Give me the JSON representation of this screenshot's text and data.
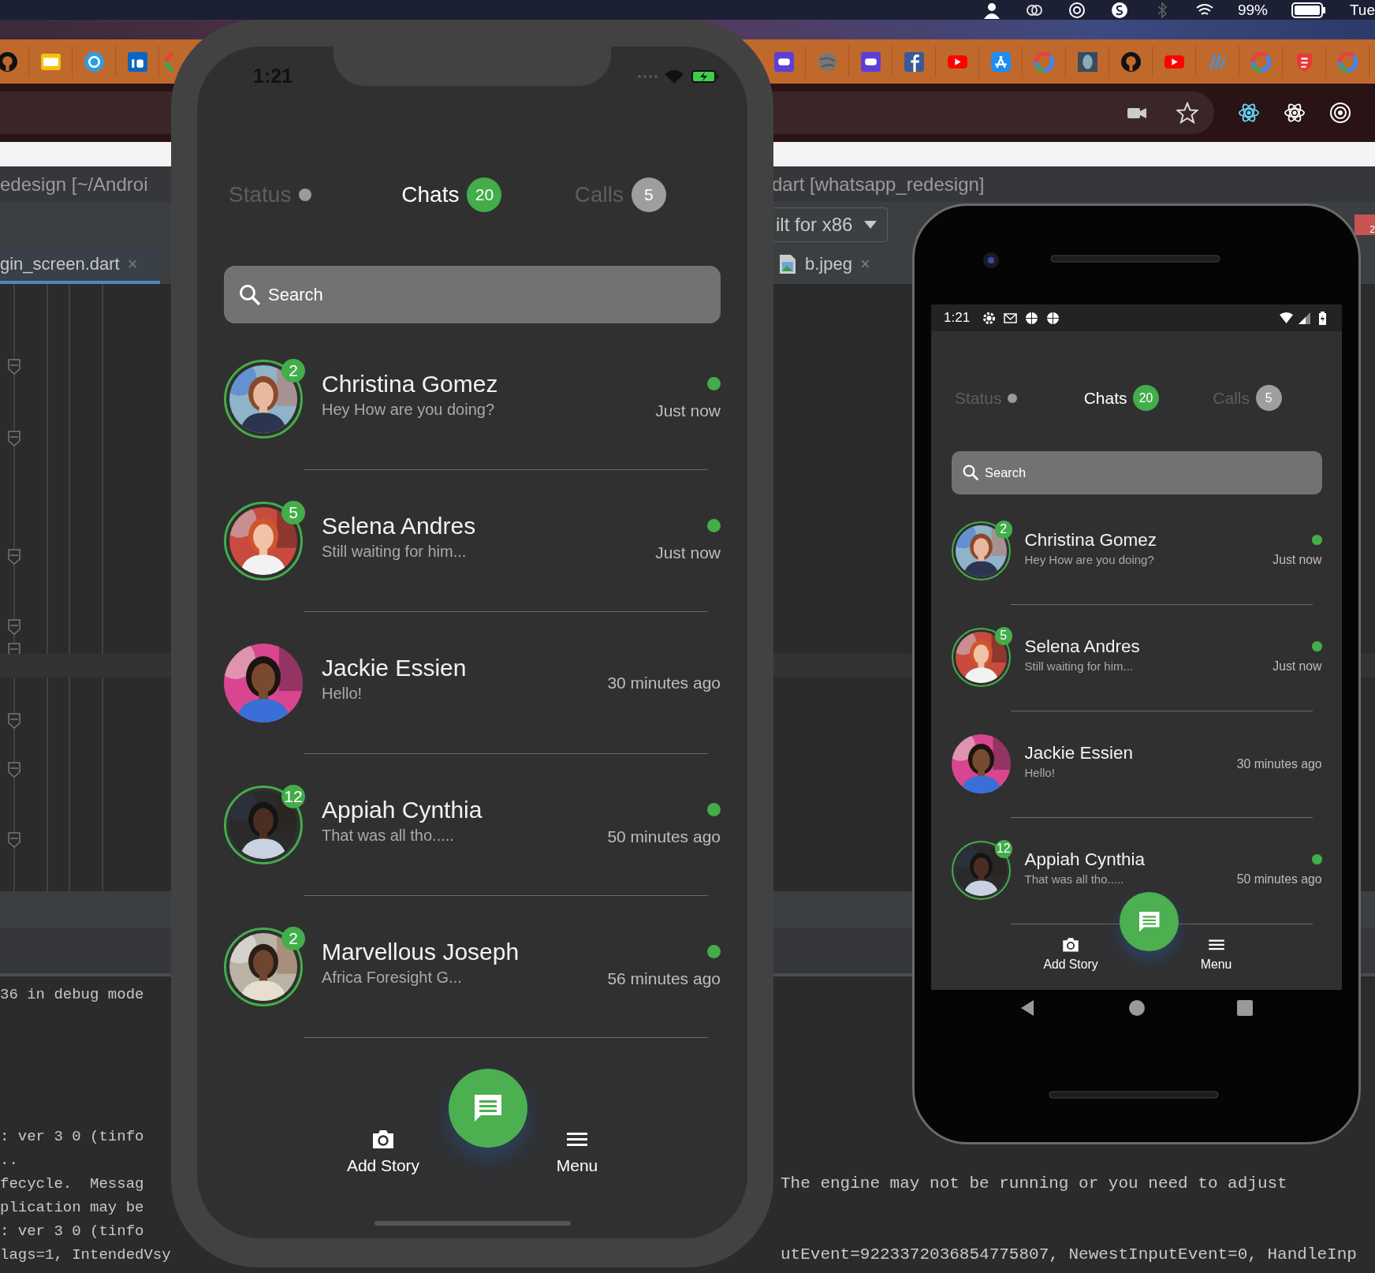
{
  "menu_bar": {
    "battery": "99%",
    "clock": "Tue"
  },
  "ide": {
    "title_left": "edesign [~/Androi",
    "title_right": "dart [whatsapp_redesign]",
    "device_dropdown": "ilt for x86",
    "error_count": "2",
    "tabs": [
      {
        "label": "gin_screen.dart",
        "close": "×",
        "selected": true
      },
      {
        "label": "b.jpeg",
        "close": "×",
        "selected": false
      }
    ],
    "console_left": [
      "36 in debug mode",
      ": ver 3 0 (tinfo",
      "..",
      "fecycle.  Messag",
      "plication may be",
      ": ver 3 0 (tinfo",
      "lags=1, IntendedVsy"
    ],
    "console_right": [
      "The engine may not be running or you need to adjust",
      "utEvent=9223372036854775807, NewestInputEvent=0, HandleInp"
    ]
  },
  "ios_phone": {
    "time": "1:21",
    "app": {
      "tabs": [
        {
          "label": "Status",
          "selected": false,
          "kind": "dot"
        },
        {
          "label": "Chats",
          "selected": true,
          "kind": "badge",
          "badge": "20"
        },
        {
          "label": "Calls",
          "selected": false,
          "kind": "badge",
          "badge": "5"
        }
      ],
      "search": {
        "placeholder": "Search"
      },
      "chats": [
        {
          "name": "Christina Gomez",
          "message": "Hey How are you doing?",
          "time": "Just now",
          "unread": "2",
          "online": true
        },
        {
          "name": "Selena Andres",
          "message": "Still waiting for him...",
          "time": "Just now",
          "unread": "5",
          "online": true
        },
        {
          "name": "Jackie Essien",
          "message": "Hello!",
          "time": "30 minutes ago",
          "online": false
        },
        {
          "name": "Appiah Cynthia",
          "message": "That was all tho.....",
          "time": "50 minutes ago",
          "unread": "12",
          "online": true
        },
        {
          "name": "Marvellous Joseph",
          "message": "Africa Foresight G...",
          "time": "56 minutes ago",
          "unread": "2",
          "online": true
        }
      ],
      "nav": [
        {
          "label": "Add Story",
          "kind": "camera"
        },
        {
          "label": "Menu",
          "kind": "menu"
        }
      ]
    }
  },
  "android_phone": {
    "time": "1:21",
    "app": {
      "tabs": [
        {
          "label": "Status",
          "selected": false,
          "kind": "dot"
        },
        {
          "label": "Chats",
          "selected": true,
          "kind": "badge",
          "badge": "20"
        },
        {
          "label": "Calls",
          "selected": false,
          "kind": "badge",
          "badge": "5"
        }
      ],
      "search": {
        "placeholder": "Search"
      },
      "chats": [
        {
          "name": "Christina Gomez",
          "message": "Hey How are you doing?",
          "time": "Just now",
          "unread": "2",
          "online": true
        },
        {
          "name": "Selena Andres",
          "message": "Still waiting for him...",
          "time": "Just now",
          "unread": "5",
          "online": true
        },
        {
          "name": "Jackie Essien",
          "message": "Hello!",
          "time": "30 minutes ago",
          "online": false
        },
        {
          "name": "Appiah Cynthia",
          "message": "That was all tho.....",
          "time": "50 minutes ago",
          "unread": "12",
          "online": true
        }
      ],
      "nav": [
        {
          "label": "Add Story",
          "kind": "camera"
        },
        {
          "label": "Menu",
          "kind": "menu"
        }
      ]
    }
  }
}
